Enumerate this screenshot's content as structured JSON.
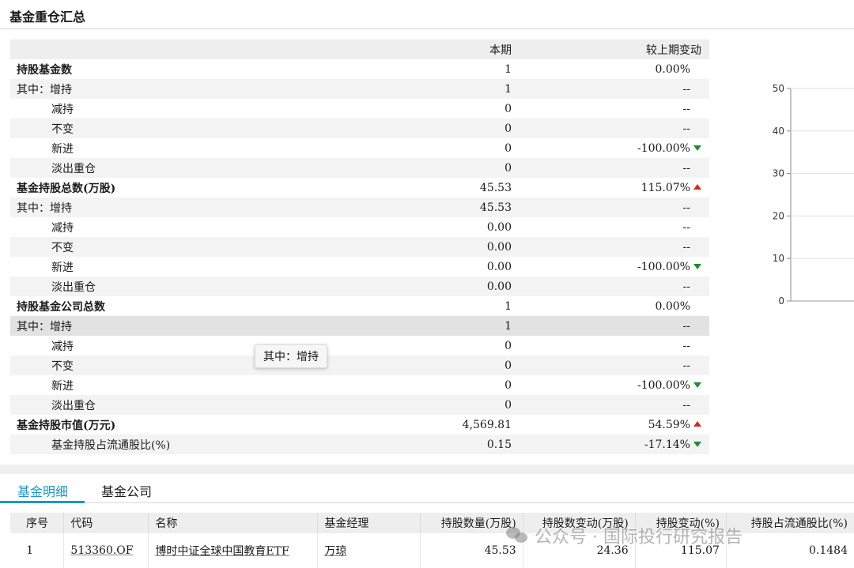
{
  "page_title": "基金重仓汇总",
  "summary": {
    "headers": {
      "label": "",
      "current": "本期",
      "change": "较上期变动"
    },
    "rows": [
      {
        "label": "持股基金数",
        "cur": "1",
        "chg": "0.00%",
        "trend": "none",
        "indent": false,
        "bold": true
      },
      {
        "label": "其中：增持",
        "cur": "1",
        "chg": "--",
        "trend": "none",
        "indent": false,
        "bold": false
      },
      {
        "label": "减持",
        "cur": "0",
        "chg": "--",
        "trend": "none",
        "indent": true,
        "bold": false
      },
      {
        "label": "不变",
        "cur": "0",
        "chg": "--",
        "trend": "none",
        "indent": true,
        "bold": false
      },
      {
        "label": "新进",
        "cur": "0",
        "chg": "-100.00%",
        "trend": "down",
        "indent": true,
        "bold": false
      },
      {
        "label": "淡出重仓",
        "cur": "0",
        "chg": "--",
        "trend": "none",
        "indent": true,
        "bold": false
      },
      {
        "label": "基金持股总数(万股)",
        "cur": "45.53",
        "chg": "115.07%",
        "trend": "up",
        "indent": false,
        "bold": true
      },
      {
        "label": "其中：增持",
        "cur": "45.53",
        "chg": "--",
        "trend": "none",
        "indent": false,
        "bold": false
      },
      {
        "label": "减持",
        "cur": "0.00",
        "chg": "--",
        "trend": "none",
        "indent": true,
        "bold": false
      },
      {
        "label": "不变",
        "cur": "0.00",
        "chg": "--",
        "trend": "none",
        "indent": true,
        "bold": false
      },
      {
        "label": "新进",
        "cur": "0.00",
        "chg": "-100.00%",
        "trend": "down",
        "indent": true,
        "bold": false
      },
      {
        "label": "淡出重仓",
        "cur": "0.00",
        "chg": "--",
        "trend": "none",
        "indent": true,
        "bold": false
      },
      {
        "label": "持股基金公司总数",
        "cur": "1",
        "chg": "0.00%",
        "trend": "none",
        "indent": false,
        "bold": true
      },
      {
        "label": "其中：增持",
        "cur": "1",
        "chg": "--",
        "trend": "none",
        "indent": false,
        "bold": false
      },
      {
        "label": "减持",
        "cur": "0",
        "chg": "--",
        "trend": "none",
        "indent": true,
        "bold": false
      },
      {
        "label": "不变",
        "cur": "0",
        "chg": "--",
        "trend": "none",
        "indent": true,
        "bold": false
      },
      {
        "label": "新进",
        "cur": "0",
        "chg": "-100.00%",
        "trend": "down",
        "indent": true,
        "bold": false
      },
      {
        "label": "淡出重仓",
        "cur": "0",
        "chg": "--",
        "trend": "none",
        "indent": true,
        "bold": false
      },
      {
        "label": "基金持股市值(万元)",
        "cur": "4,569.81",
        "chg": "54.59%",
        "trend": "up",
        "indent": false,
        "bold": true
      },
      {
        "label": "基金持股占流通股比(%)",
        "cur": "0.15",
        "chg": "-17.14%",
        "trend": "down",
        "indent": true,
        "bold": false
      }
    ],
    "highlighted_row": 13
  },
  "tooltip_text": "其中：增持",
  "axis": {
    "ticks": [
      "50",
      "40",
      "30",
      "20",
      "10",
      "0"
    ],
    "range": [
      0,
      50
    ]
  },
  "tabs": [
    {
      "label": "基金明细",
      "active": true
    },
    {
      "label": "基金公司",
      "active": false
    }
  ],
  "detail_table": {
    "headers": [
      "序号",
      "代码",
      "名称",
      "基金经理",
      "持股数量(万股)",
      "持股数变动(万股)",
      "持股变动(%)",
      "持股占流通股比(%)"
    ],
    "rows": [
      [
        "1",
        "513360.OF",
        "博时中证全球中国教育ETF",
        "万琼",
        "45.53",
        "24.36",
        "115.07",
        "0.1484"
      ]
    ]
  },
  "watermark": "公众号 · 国际投行研究报告",
  "colors": {
    "up": "#d9261c",
    "down": "#1a8f2d",
    "tab_active": "#1e96c8"
  }
}
